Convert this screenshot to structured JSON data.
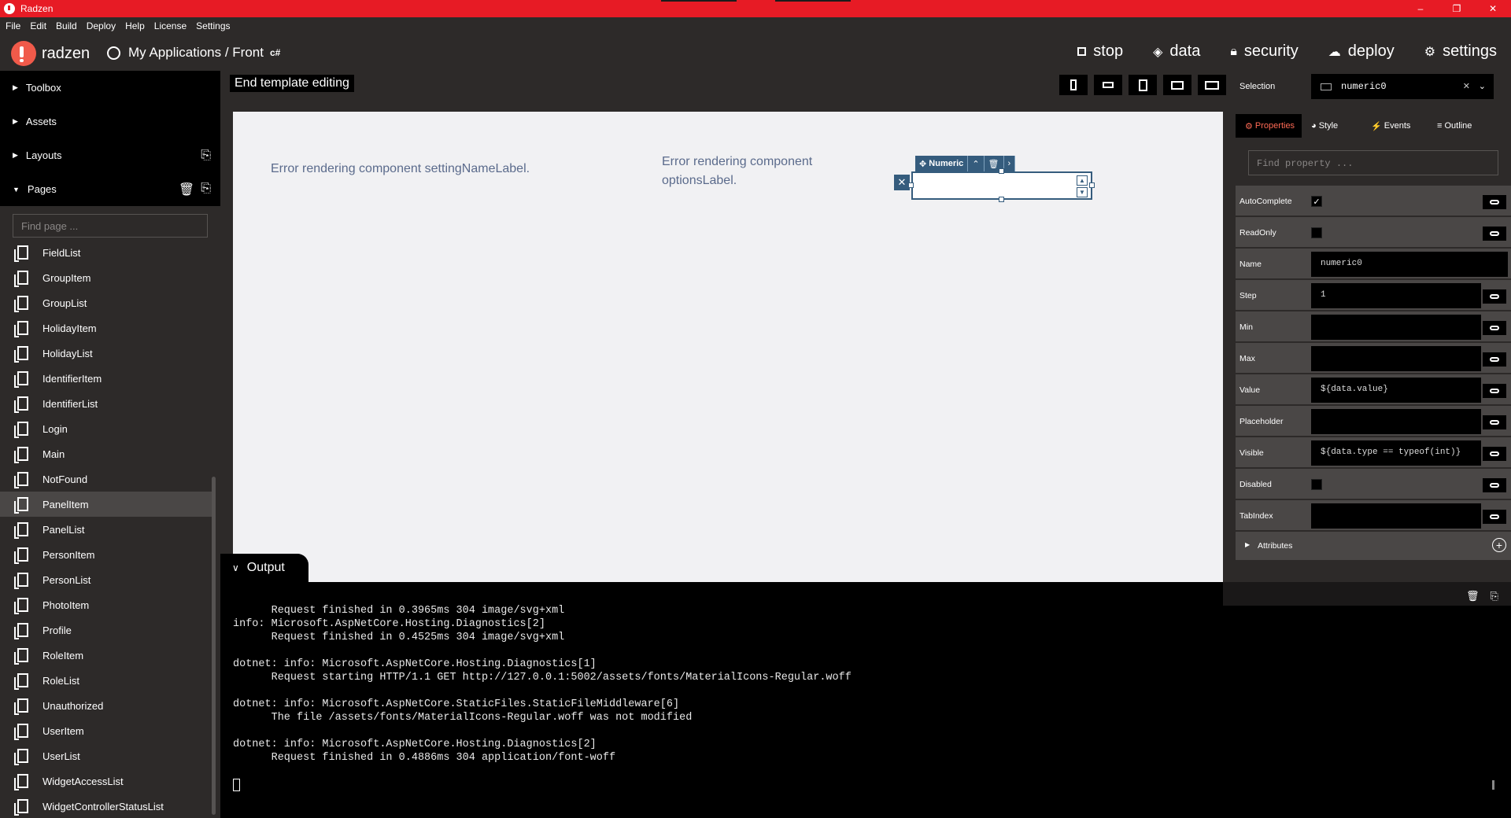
{
  "window": {
    "title": "Radzen",
    "controls": {
      "minimize": "–",
      "restore": "❐",
      "close": "✕"
    }
  },
  "menu": [
    "File",
    "Edit",
    "Build",
    "Deploy",
    "Help",
    "License",
    "Settings"
  ],
  "header": {
    "brand": "radzen",
    "breadcrumb": "My Applications / Front",
    "lang_badge": "c#",
    "nav": {
      "stop": "stop",
      "data": "data",
      "security": "security",
      "deploy": "deploy",
      "settings": "settings"
    }
  },
  "sidebar": {
    "sections": {
      "toolbox": "Toolbox",
      "assets": "Assets",
      "layouts": "Layouts",
      "pages": "Pages"
    },
    "find_placeholder": "Find page ...",
    "pages": [
      "FieldList",
      "GroupItem",
      "GroupList",
      "HolidayItem",
      "HolidayList",
      "IdentifierItem",
      "IdentifierList",
      "Login",
      "Main",
      "NotFound",
      "PanelItem",
      "PanelList",
      "PersonItem",
      "PersonList",
      "PhotoItem",
      "Profile",
      "RoleItem",
      "RoleList",
      "Unauthorized",
      "UserItem",
      "UserList",
      "WidgetAccessList",
      "WidgetControllerStatusList"
    ],
    "active_page": "PanelItem"
  },
  "designer": {
    "end_template_label": "End template editing",
    "error_setting_name": "Error rendering component settingNameLabel.",
    "error_options": "Error rendering component optionsLabel.",
    "numeric_toolbar_label": "Numeric"
  },
  "output": {
    "tab_label": "Output",
    "log": "      Request finished in 0.3965ms 304 image/svg+xml\ninfo: Microsoft.AspNetCore.Hosting.Diagnostics[2]\n      Request finished in 0.4525ms 304 image/svg+xml\n\ndotnet: info: Microsoft.AspNetCore.Hosting.Diagnostics[1]\n      Request starting HTTP/1.1 GET http://127.0.0.1:5002/assets/fonts/MaterialIcons-Regular.woff\n\ndotnet: info: Microsoft.AspNetCore.StaticFiles.StaticFileMiddleware[6]\n      The file /assets/fonts/MaterialIcons-Regular.woff was not modified\n\ndotnet: info: Microsoft.AspNetCore.Hosting.Diagnostics[2]\n      Request finished in 0.4886ms 304 application/font-woff"
  },
  "properties_panel": {
    "selection_label": "Selection",
    "selection_value": "numeric0",
    "tabs": {
      "properties": "Properties",
      "style": "Style",
      "events": "Events",
      "outline": "Outline"
    },
    "find_placeholder": "Find property ...",
    "rows": {
      "autocomplete": {
        "label": "AutoComplete",
        "checked": "✓"
      },
      "readonly": {
        "label": "ReadOnly"
      },
      "name": {
        "label": "Name",
        "value": "numeric0"
      },
      "step": {
        "label": "Step",
        "value": "1"
      },
      "min": {
        "label": "Min",
        "value": ""
      },
      "max": {
        "label": "Max",
        "value": ""
      },
      "value": {
        "label": "Value",
        "value": "${data.value}"
      },
      "placeholder": {
        "label": "Placeholder",
        "value": ""
      },
      "visible": {
        "label": "Visible",
        "value": "${data.type == typeof(int)}"
      },
      "disabled": {
        "label": "Disabled"
      },
      "tabindex": {
        "label": "TabIndex",
        "value": ""
      }
    },
    "attributes_label": "Attributes"
  },
  "colors": {
    "titlebar": "#e71b25",
    "accent": "#ff6a55",
    "selection_blue": "#355c7d"
  }
}
